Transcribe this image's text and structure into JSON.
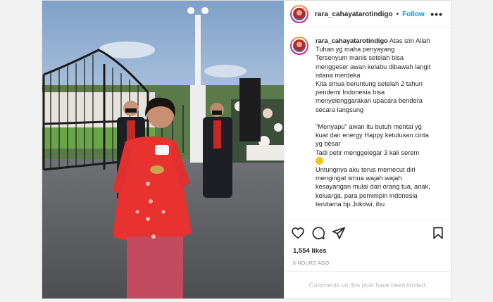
{
  "post": {
    "username": "rara_cahayatarotindigo",
    "separator": "•",
    "follow_label": "Follow",
    "more_label": "•••",
    "caption_user": "rara_cahayatarotindigo",
    "caption_text": " Atas izin Allah Tuhan yg maha penyayang\nTersenyum manis setelah bisa menggeser awan kelabu dibawah langit istana merdeka\nKita smua beruntung setelah 2 tahun pendemi Indonesia bisa menyelenggarakan upacara bendera secara langsung\n\n\"Menyapu\" awan itu butuh mental yg kuat dan energy Happy ketulusan cinta yg besar\nTadi petir menggelegar 3 kali serem",
    "caption_text_2": "Untungnya aku terus memecut diri mengingat smua wajah wajah kesayangan mulai dari orang tua, anak, keluarga, para pemimpin indonesia terutama bp Jokowi, ibu",
    "emoji": "worried-face",
    "likes": "1,554 likes",
    "time": "6 HOURS AGO",
    "comments_limited": "Comments on this post have been limited."
  },
  "icons": {
    "like": "heart-icon",
    "comment": "comment-icon",
    "share": "share-icon",
    "save": "bookmark-icon"
  },
  "colors": {
    "link": "#0095f6",
    "text": "#262626",
    "muted": "#8e8e8e",
    "dress": "#e8322f"
  }
}
